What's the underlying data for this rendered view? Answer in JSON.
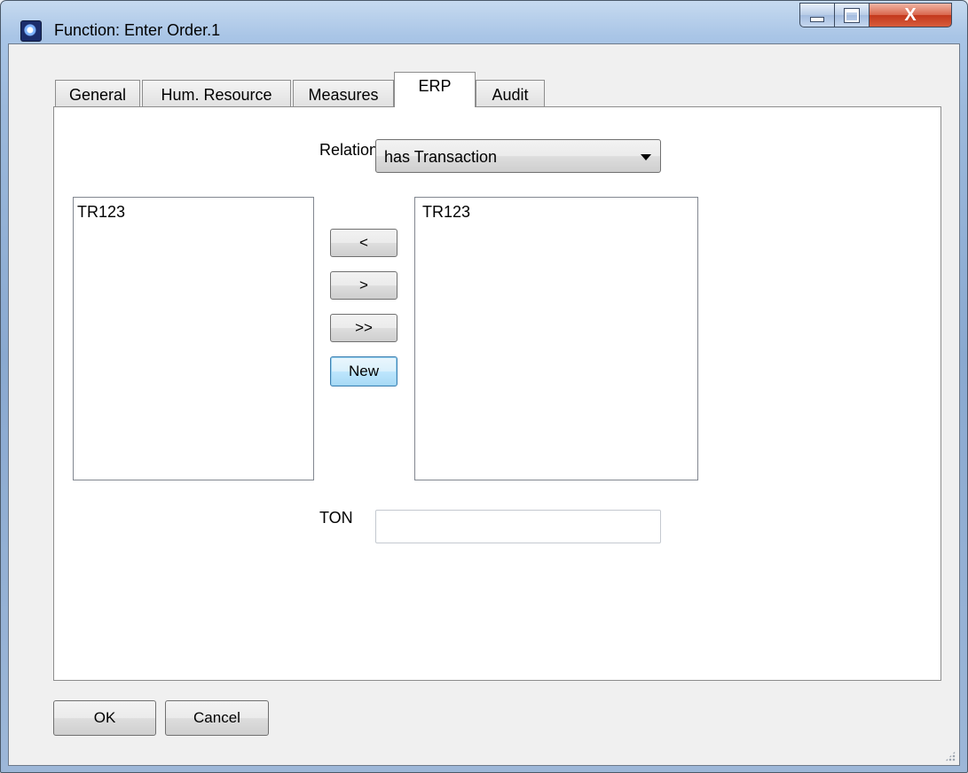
{
  "window": {
    "title": "Function: Enter Order.1",
    "close_glyph": "X"
  },
  "tabs": [
    {
      "label": "General",
      "active": false
    },
    {
      "label": "Hum. Resource",
      "active": false
    },
    {
      "label": "Measures",
      "active": false
    },
    {
      "label": "ERP",
      "active": true
    },
    {
      "label": "Audit",
      "active": false
    }
  ],
  "erp": {
    "relation_label": "Relation",
    "relation_value": "has Transaction",
    "left_list": [
      "TR123"
    ],
    "right_list": [
      "TR123"
    ],
    "buttons": {
      "move_left": "<",
      "move_right": ">",
      "move_all_right": ">>",
      "new": "New"
    },
    "ton_label": "TON",
    "ton_value": ""
  },
  "footer": {
    "ok_label": "OK",
    "cancel_label": "Cancel"
  },
  "icons": {
    "app": "app-globe-icon",
    "minimize": "minimize-icon",
    "maximize": "maximize-icon",
    "close": "close-icon",
    "dropdown": "chevron-down-icon",
    "resize": "resize-grip-icon"
  }
}
